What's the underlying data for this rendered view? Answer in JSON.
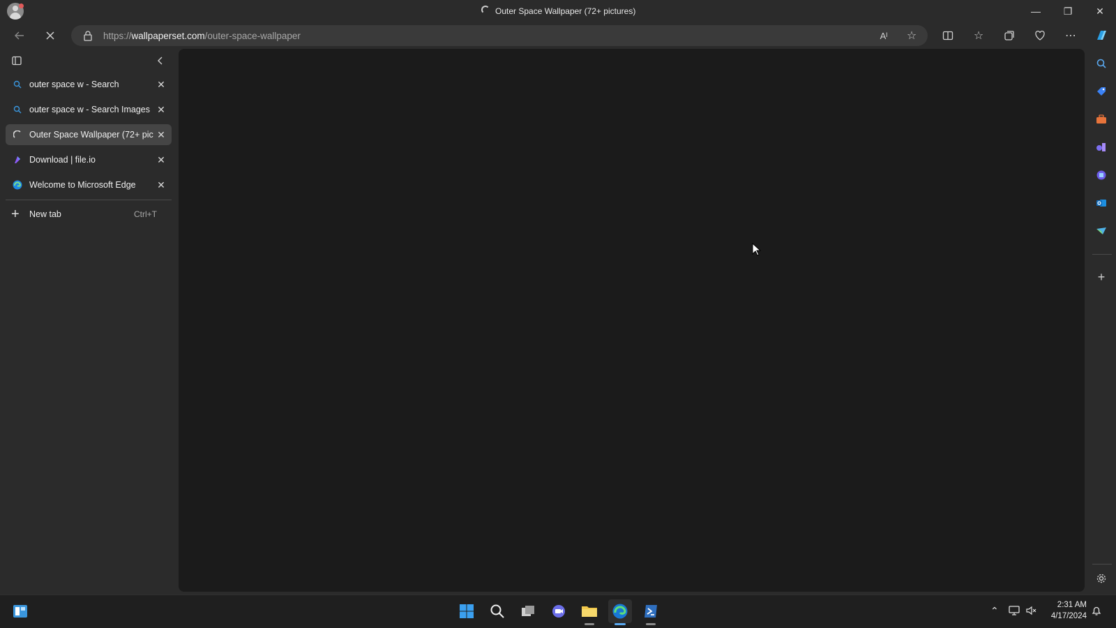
{
  "window": {
    "title": "Outer Space Wallpaper (72+ pictures)"
  },
  "toolbar": {
    "url_scheme": "https://",
    "url_host": "wallpaperset.com",
    "url_path": "/outer-space-wallpaper",
    "loading": true
  },
  "tabs": [
    {
      "label": "outer space w - Search",
      "icon": "search-icon",
      "active": false
    },
    {
      "label": "outer space w - Search Images",
      "icon": "search-icon",
      "active": false
    },
    {
      "label": "Outer Space Wallpaper (72+ pictures)",
      "icon": "loading-spinner-icon",
      "active": true
    },
    {
      "label": "Download | file.io",
      "icon": "fileio-icon",
      "active": false
    },
    {
      "label": "Welcome to Microsoft Edge",
      "icon": "edge-icon",
      "active": false
    }
  ],
  "new_tab": {
    "label": "New tab",
    "shortcut": "Ctrl+T"
  },
  "system": {
    "time": "2:31 AM",
    "date": "4/17/2024"
  },
  "colors": {
    "chrome_bg": "#2b2b2b",
    "content_bg": "#1b1b1b",
    "active_tab": "#454545",
    "taskbar_bg": "#1f1f1f",
    "accent": "#3a96dd"
  }
}
